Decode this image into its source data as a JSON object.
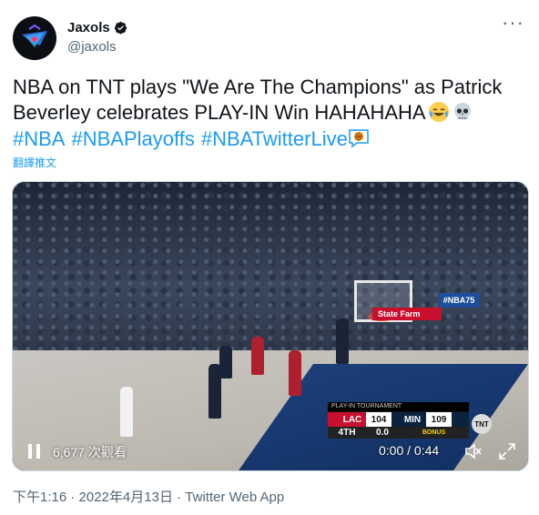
{
  "author": {
    "name": "Jaxols",
    "handle": "@jaxols"
  },
  "tweet": {
    "line1": "NBA on TNT plays \"We Are The Champions\" as Patrick",
    "line2": "Beverley celebrates PLAY-IN Win  HAHAHAHA",
    "emojis": [
      "face-with-tears-of-joy",
      "skull"
    ],
    "hashtags": [
      "#NBA",
      "#NBAPlayoffs",
      "#NBATwitterLive"
    ],
    "translate": "翻譯推文"
  },
  "video": {
    "views": "6,677 次觀看",
    "time": "0:00 / 0:44",
    "scorebug": {
      "header": "PLAY-IN TOURNAMENT",
      "team1": "LAC",
      "score1": "104",
      "team2": "MIN",
      "score2": "109",
      "bonus": "BONUS",
      "period": "4TH",
      "clock": "0.0",
      "network": "TNT"
    },
    "sponsor": "State Farm",
    "banner": "#NBA75"
  },
  "meta": {
    "time": "下午1:16",
    "date": "2022年4月13日",
    "source": "Twitter Web App"
  },
  "colors": {
    "link": "#1d9bf0",
    "text": "#0f1419",
    "muted": "#536471"
  }
}
